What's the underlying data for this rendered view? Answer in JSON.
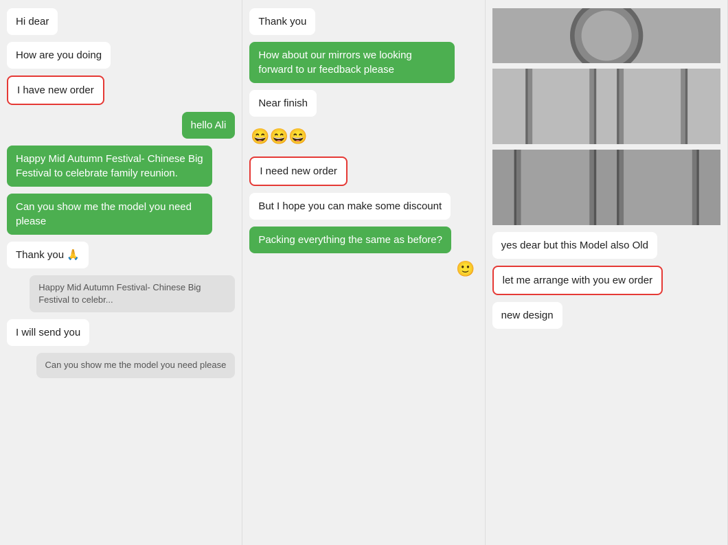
{
  "col1": {
    "messages": [
      {
        "id": "hi-dear",
        "text": "Hi dear",
        "type": "left-white"
      },
      {
        "id": "how-are-you",
        "text": "How are you doing",
        "type": "left-white"
      },
      {
        "id": "i-have-new-order",
        "text": "I have new order",
        "type": "left-outlined"
      },
      {
        "id": "hello-ali",
        "text": "hello Ali",
        "type": "right-green"
      },
      {
        "id": "happy-festival",
        "text": "Happy Mid Autumn Festival- Chinese Big Festival to celebrate family reunion.",
        "type": "left-green"
      },
      {
        "id": "can-you-show",
        "text": "Can you show me the model you need please",
        "type": "left-green"
      },
      {
        "id": "thank-you-pray",
        "text": "Thank you 🙏",
        "type": "left-white"
      },
      {
        "id": "happy-festival-small",
        "text": "Happy Mid Autumn Festival- Chinese Big Festival to celebr...",
        "type": "right-gray"
      },
      {
        "id": "i-will-send",
        "text": "I will send you",
        "type": "left-white"
      },
      {
        "id": "can-you-show-small",
        "text": "Can you show me the model you need please",
        "type": "right-gray"
      }
    ]
  },
  "col2": {
    "messages": [
      {
        "id": "thank-you",
        "text": "Thank you",
        "type": "left-white"
      },
      {
        "id": "how-about-mirrors",
        "text": "How about our mirrors we looking forward to ur feedback please",
        "type": "left-green"
      },
      {
        "id": "near-finish",
        "text": "Near finish",
        "type": "left-white"
      },
      {
        "id": "emoji-row",
        "text": "😄😄😄",
        "type": "emoji"
      },
      {
        "id": "i-need-new-order",
        "text": "I need new order",
        "type": "left-outlined"
      },
      {
        "id": "but-hope",
        "text": "But I hope you can make some discount",
        "type": "left-white"
      },
      {
        "id": "packing",
        "text": "Packing everything the same as before?",
        "type": "left-green"
      },
      {
        "id": "smile-icon",
        "text": "🙂",
        "type": "right-icon"
      }
    ]
  },
  "col3": {
    "messages": [
      {
        "id": "yes-dear",
        "text": "yes dear but this Model also Old",
        "type": "left-white"
      },
      {
        "id": "let-me-arrange",
        "text": "let me arrange with you ew order",
        "type": "left-outlined"
      },
      {
        "id": "new-design",
        "text": "new design",
        "type": "left-white"
      }
    ],
    "images": [
      {
        "id": "img-top",
        "cls": "img-top"
      },
      {
        "id": "img-mid",
        "cls": "img-mid"
      },
      {
        "id": "img-bot",
        "cls": "img-bot"
      }
    ]
  }
}
